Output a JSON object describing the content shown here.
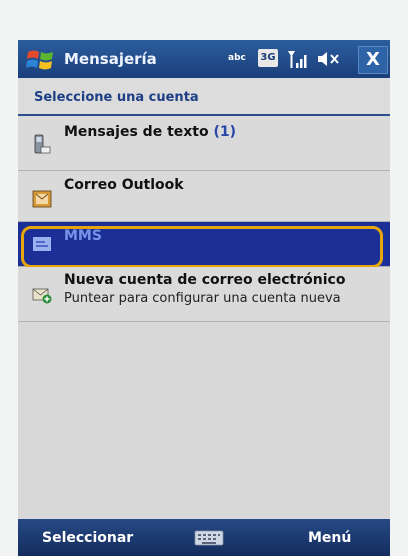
{
  "titlebar": {
    "title": "Mensajería",
    "input_mode": "abc",
    "network": "3G",
    "close_label": "X"
  },
  "section_header": "Seleccione una cuenta",
  "accounts": [
    {
      "label": "Mensajes de texto",
      "count": "(1)",
      "icon": "sms-phone-icon"
    },
    {
      "label": "Correo Outlook",
      "icon": "outlook-mail-icon"
    },
    {
      "label": "MMS",
      "icon": "mms-icon",
      "selected": true
    },
    {
      "label": "Nueva cuenta de correo electrónico",
      "sublabel": "Puntear para configurar una cuenta nueva",
      "icon": "new-email-account-icon"
    }
  ],
  "softkeys": {
    "left": "Seleccionar",
    "right": "Menú",
    "center_icon": "keyboard-icon"
  },
  "colors": {
    "titlebar": "#1f4787",
    "selection": "#1c2f96",
    "highlight_ring": "#e7a70c",
    "header_text": "#1e3f85"
  }
}
